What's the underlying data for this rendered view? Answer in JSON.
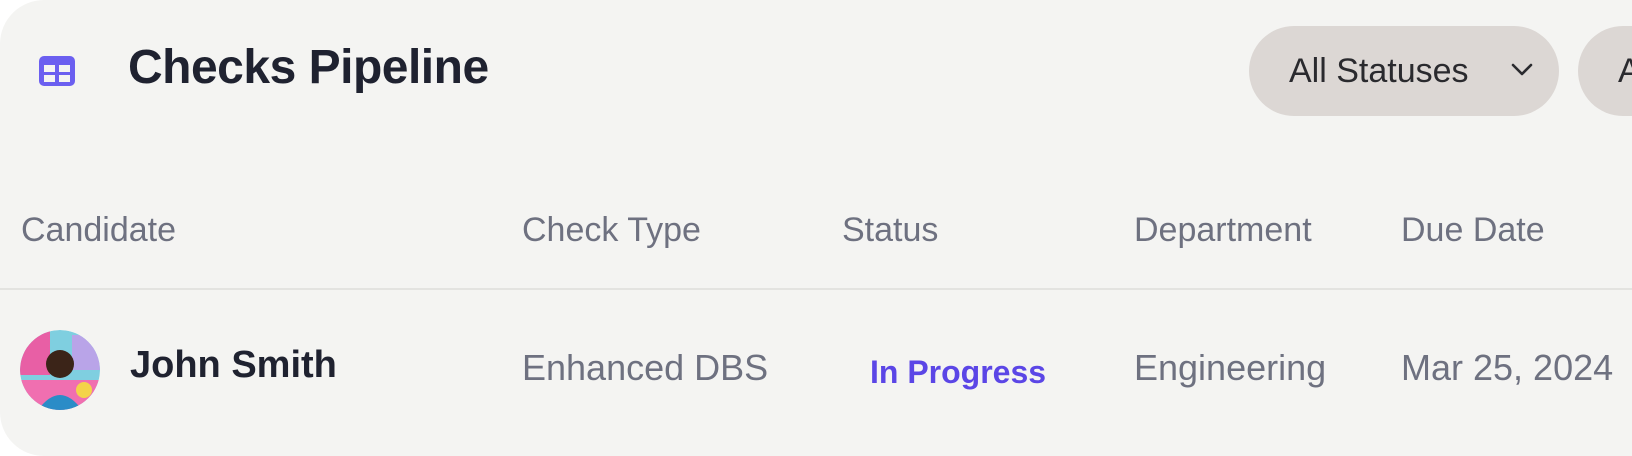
{
  "header": {
    "title": "Checks Pipeline",
    "table_icon": "table-grid-icon",
    "filter_status_label": "All Statuses",
    "filter_second_label": "A"
  },
  "table": {
    "columns": [
      "Candidate",
      "Check Type",
      "Status",
      "Department",
      "Due Date"
    ],
    "rows": [
      {
        "candidate": "John Smith",
        "check_type": "Enhanced DBS",
        "status": "In Progress",
        "department": "Engineering",
        "due_date": "Mar 25, 2024"
      }
    ]
  },
  "colors": {
    "accent": "#6b5ff0",
    "status_in_progress": "#5b46e6",
    "title": "#1f2230",
    "muted_text": "#6e7180",
    "pill_bg": "#dcd7d4",
    "card_bg": "#f4f4f2"
  }
}
